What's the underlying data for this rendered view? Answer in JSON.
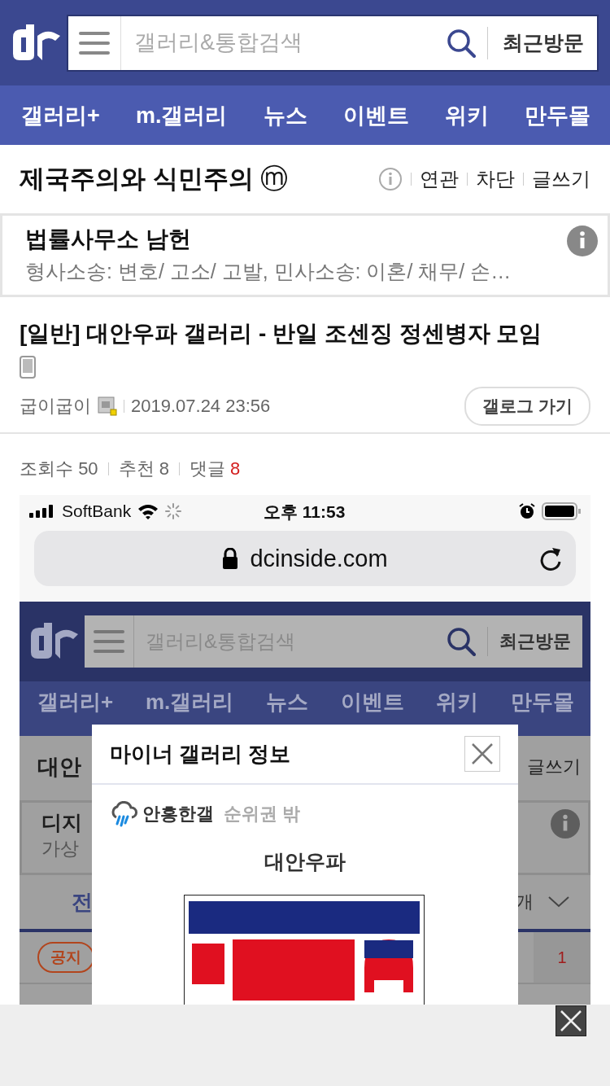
{
  "header": {
    "search": {
      "placeholder": "갤러리&통합검색"
    },
    "recent_button": "최근방문"
  },
  "nav": [
    "갤러리+",
    "m.갤러리",
    "뉴스",
    "이벤트",
    "위키",
    "만두몰"
  ],
  "gallery": {
    "title": "제국주의와 식민주의",
    "badge": "ⓜ",
    "actions": [
      "연관",
      "차단",
      "글쓰기"
    ]
  },
  "ad": {
    "title": "법률사무소 남헌",
    "text": "형사소송: 변호/ 고소/ 고발, 민사소송: 이혼/ 채무/ 손…"
  },
  "post": {
    "title": "[일반] 대안우파 갤러리 - 반일 조센징 정센병자 모임",
    "author": "굽이굽이",
    "date": "2019.07.24 23:56",
    "gallog_button": "갤로그 가기",
    "stats": [
      {
        "label": "조회수",
        "value": "50",
        "kind": "plain"
      },
      {
        "label": "추천",
        "value": "8",
        "kind": "plain"
      },
      {
        "label": "댓글",
        "value": "8",
        "kind": "highlight"
      }
    ]
  },
  "screenshot": {
    "status_bar": {
      "carrier": "SoftBank",
      "time": "오후 11:53"
    },
    "url": "dcinside.com",
    "page": {
      "search": {
        "placeholder": "갤러리&통합검색"
      },
      "recent_button": "최근방문",
      "nav": [
        "갤러리+",
        "m.갤러리",
        "뉴스",
        "이벤트",
        "위키",
        "만두몰"
      ],
      "gallery_title": "대안",
      "write_button": "글쓰기",
      "ad_title": "디지",
      "ad_text": "가상",
      "tab": "전",
      "count": "개",
      "notice_badge": "공지",
      "reply_count": "1"
    },
    "modal": {
      "title": "마이너 갤러리 정보",
      "rank_name": "안흥한갤",
      "rank_status": "순위권 밖",
      "gallery_name": "대안우파"
    }
  }
}
